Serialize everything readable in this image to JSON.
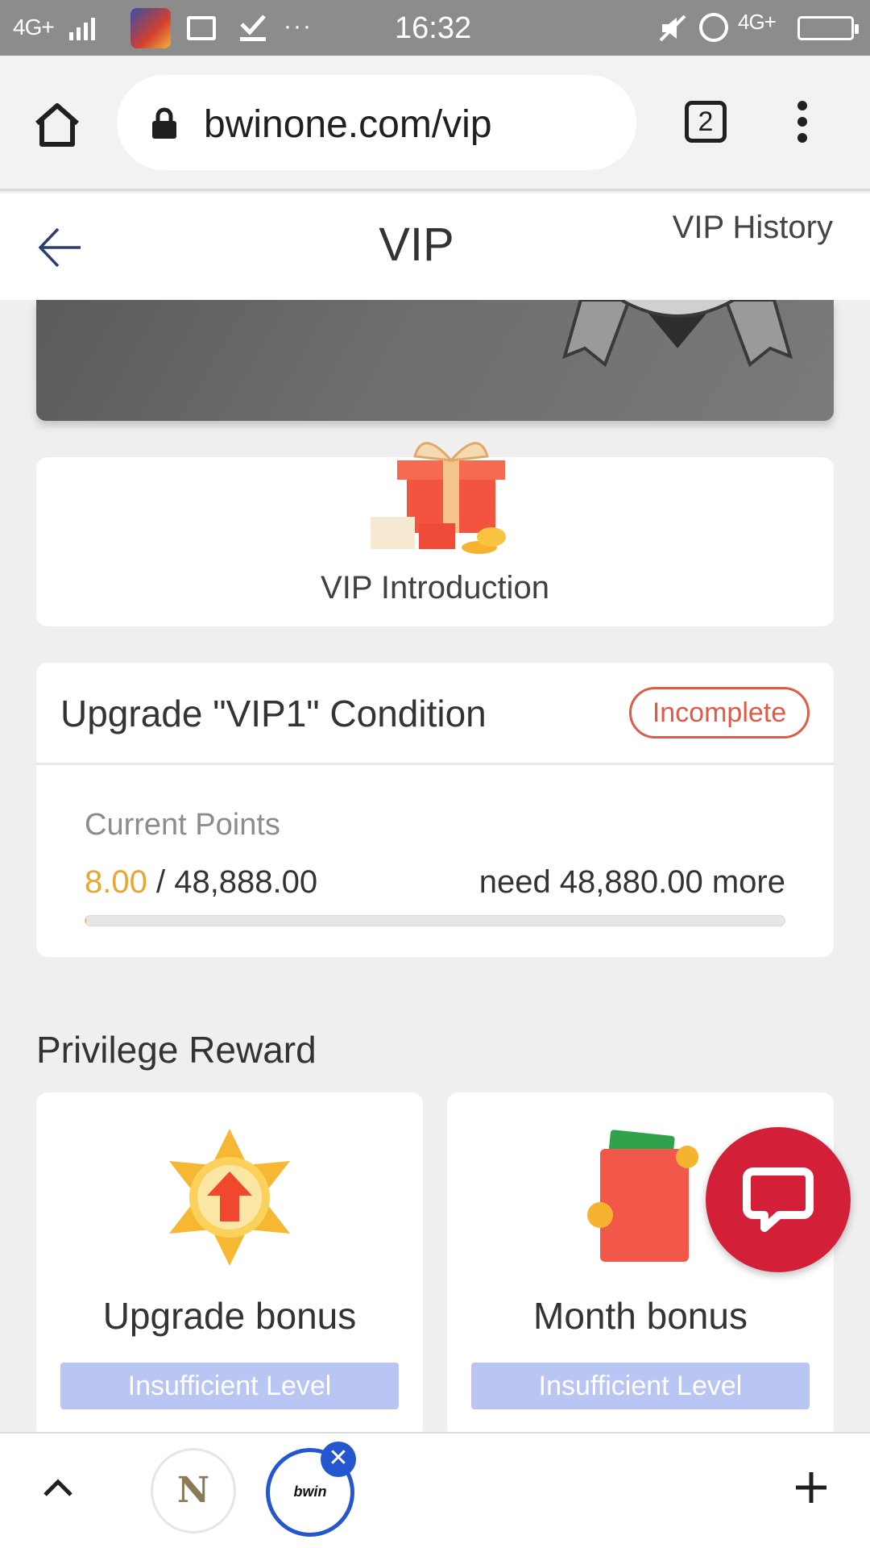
{
  "status_bar": {
    "network_left": "4G+",
    "network_right": "4G+",
    "time": "16:32",
    "more": "···"
  },
  "browser": {
    "url": "bwinone.com/vip",
    "tab_count": "2"
  },
  "header": {
    "title": "VIP",
    "history_label": "VIP History"
  },
  "intro": {
    "label": "VIP Introduction"
  },
  "condition": {
    "title": "Upgrade \"VIP1\" Condition",
    "status": "Incomplete",
    "points_label": "Current Points",
    "current_points": "8.00",
    "separator": " / ",
    "target_points": "48,888.00",
    "need_text": "need 48,880.00 more",
    "progress_fraction": 0.0002
  },
  "privilege": {
    "title": "Privilege Reward",
    "rewards": [
      {
        "name": "Upgrade bonus",
        "button": "Insufficient Level",
        "icon": "upgrade-star-icon"
      },
      {
        "name": "Month bonus",
        "button": "Insufficient Level",
        "icon": "red-envelope-icon"
      }
    ]
  },
  "bottom_bar": {
    "tab_n_label": "N",
    "tab_bwin_label": "bwin",
    "close_glyph": "✕"
  },
  "colors": {
    "accent_orange": "#e8a72e",
    "status_red": "#e05a46",
    "disabled_blue": "#b9c6f3",
    "chat_red": "#d31f37",
    "tab_blue": "#2456cf"
  }
}
